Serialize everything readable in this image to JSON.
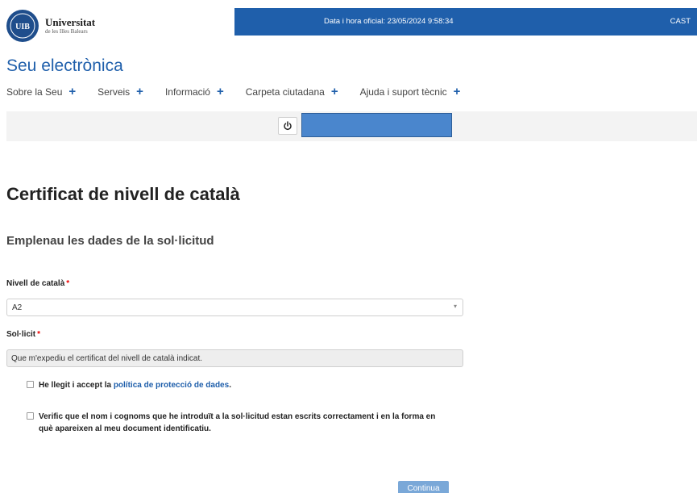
{
  "header": {
    "logo_main": "Universitat",
    "logo_sub": "de les Illes Balears",
    "logo_seal_text": "UIB",
    "datetime": "Data i hora oficial: 23/05/2024  9:58:34",
    "lang": "CAST"
  },
  "site_title": "Seu electrònica",
  "nav": [
    {
      "label": "Sobre la Seu"
    },
    {
      "label": "Serveis"
    },
    {
      "label": "Informació"
    },
    {
      "label": "Carpeta ciutadana"
    },
    {
      "label": "Ajuda i suport tècnic"
    }
  ],
  "nav_plus": "+",
  "icons": {
    "power": "power-icon",
    "plus": "plus-icon",
    "select_arrow": "chevron-down-icon"
  },
  "colors": {
    "brand_blue": "#1f5fab",
    "user_box": "#4a86cd",
    "required": "#e00000",
    "button": "#7aa8d8"
  },
  "page": {
    "title": "Certificat de nivell de català",
    "section_title": "Emplenau les dades de la sol·licitud"
  },
  "form": {
    "nivell_label": "Nivell de català",
    "nivell_value": "A2",
    "solicit_label": "Sol·licit",
    "solicit_value": "Que m'expediu el certificat del nivell de català indicat.",
    "required_mark": "*",
    "check1_prefix": "He llegit i accept la ",
    "check1_link": "política de protecció de dades",
    "check1_suffix": ".",
    "check2_text": "Verific que el nom i cognoms que he introduït a la sol·licitud estan escrits correctament i en la forma en què apareixen al meu document identificatiu.",
    "continue_label": "Continua"
  }
}
